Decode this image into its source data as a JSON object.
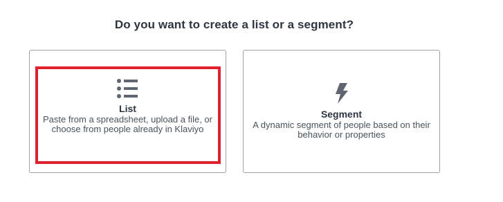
{
  "prompt": {
    "title": "Do you want to create a list or a segment?"
  },
  "options": {
    "list": {
      "icon": "list-icon",
      "label": "List",
      "description": "Paste from a spreadsheet, upload a file, or choose from people already in Klaviyo"
    },
    "segment": {
      "icon": "lightning-bolt-icon",
      "label": "Segment",
      "description": "A dynamic segment of people based on their behavior or properties"
    }
  },
  "colors": {
    "highlight": "#e0202a",
    "icon": "#5f6670",
    "text_dark": "#2d3540",
    "card_border": "#9aa0a6"
  }
}
